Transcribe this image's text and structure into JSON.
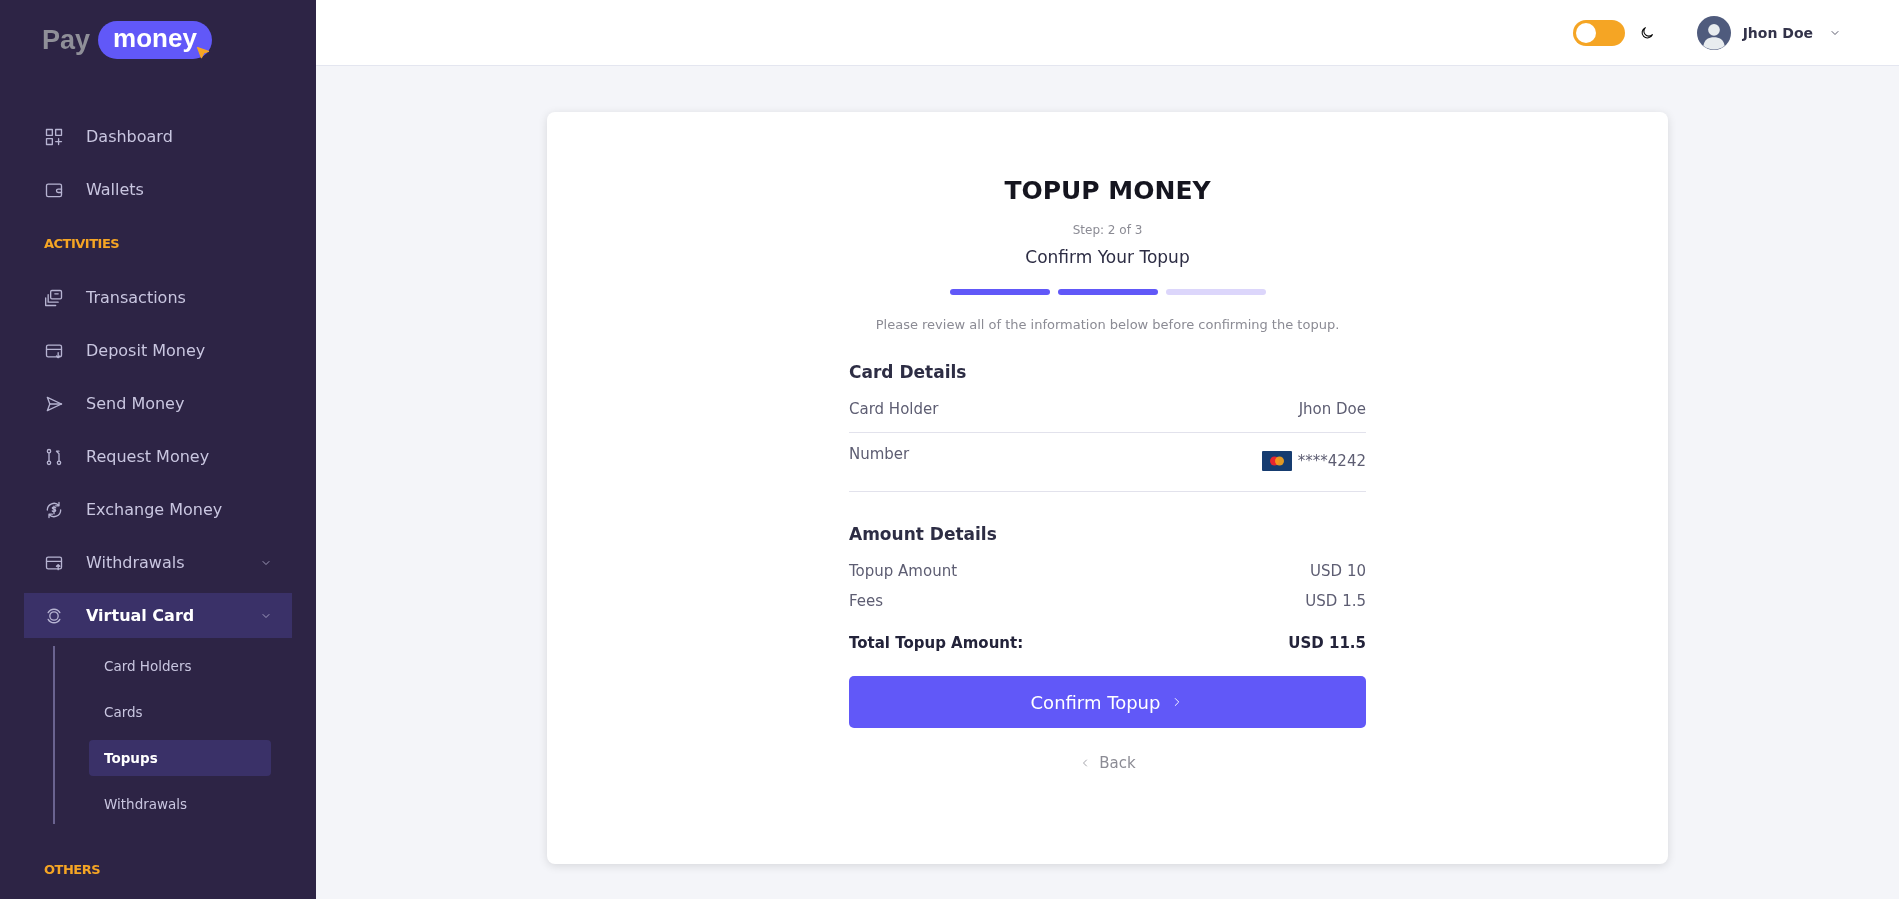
{
  "sidebar": {
    "logo": {
      "prefix": "Pay",
      "badge": "money"
    },
    "nav": [
      {
        "kind": "link",
        "label": "Dashboard",
        "selected": false
      },
      {
        "kind": "link",
        "label": "Wallets",
        "selected": false
      },
      {
        "kind": "heading",
        "label": "ACTIVITIES"
      },
      {
        "kind": "link",
        "label": "Transactions",
        "selected": false
      },
      {
        "kind": "link",
        "label": "Deposit Money",
        "selected": false
      },
      {
        "kind": "link",
        "label": "Send Money",
        "selected": false
      },
      {
        "kind": "link",
        "label": "Request Money",
        "selected": false
      },
      {
        "kind": "link",
        "label": "Exchange Money",
        "selected": false
      },
      {
        "kind": "group",
        "label": "Withdrawals",
        "selected": false
      },
      {
        "kind": "group",
        "label": "Virtual Card",
        "selected": true,
        "children": [
          {
            "label": "Card Holders",
            "selected": false
          },
          {
            "label": "Cards",
            "selected": false
          },
          {
            "label": "Topups",
            "selected": true
          },
          {
            "label": "Withdrawals",
            "selected": false
          }
        ]
      },
      {
        "kind": "heading",
        "label": "OTHERS"
      }
    ]
  },
  "header": {
    "dark_mode": {
      "on": false
    },
    "user": {
      "name": "Jhon Doe"
    }
  },
  "card": {
    "title": "TOPUP MONEY",
    "step": "Step: 2 of 3",
    "subtitle": "Confirm Your Topup",
    "progress": [
      {
        "completed": true
      },
      {
        "completed": true
      },
      {
        "completed": false
      }
    ],
    "note": "Please review all of the information below before confirming the topup.",
    "sections": [
      {
        "heading": "Card Details",
        "rows": [
          {
            "kind": "text",
            "label": "Card Holder",
            "value": "Jhon Doe"
          },
          {
            "kind": "card",
            "label": "Number",
            "value": "****4242"
          }
        ]
      },
      {
        "heading": "Amount Details",
        "rows": [
          {
            "kind": "text",
            "label": "Topup Amount",
            "value": "USD 10"
          },
          {
            "kind": "text",
            "label": "Fees",
            "value": "USD 1.5"
          }
        ]
      }
    ],
    "total": {
      "label": "Total Topup Amount:",
      "value": "USD 11.5"
    },
    "confirm_button": "Confirm Topup",
    "back_link": "Back"
  }
}
